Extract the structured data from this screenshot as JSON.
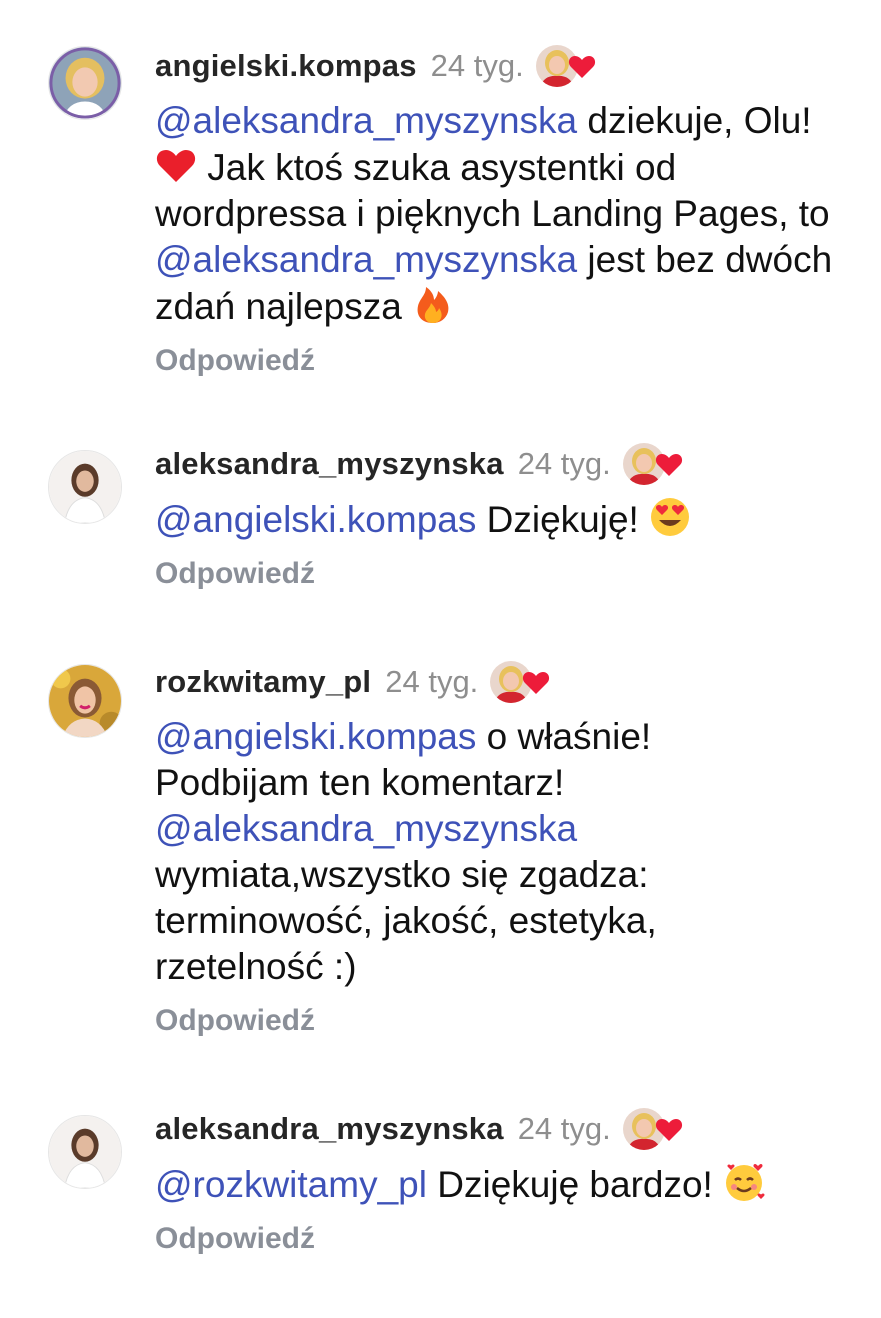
{
  "comments": [
    {
      "username": "angielski.kompas",
      "time": "24 tyg.",
      "text": {
        "m1": "@aleksandra_myszynska",
        "t1": " dziekuje, Olu! ",
        "t2": " Jak ktoś szuka asystentki od wordpressa i pięknych Landing Pages, to ",
        "m2": "@aleksandra_myszynska",
        "t3": " jest bez dwóch zdań najlepsza "
      },
      "emojis": [
        "red-heart-emoji",
        "fire-emoji"
      ],
      "reply_label": "Odpowiedź"
    },
    {
      "username": "aleksandra_myszynska",
      "time": "24 tyg.",
      "text": {
        "m1": "@angielski.kompas",
        "t1": " Dziękuję! "
      },
      "emojis": [
        "heart-eyes-emoji"
      ],
      "reply_label": "Odpowiedź"
    },
    {
      "username": "rozkwitamy_pl",
      "time": "24 tyg.",
      "text": {
        "m1": "@angielski.kompas",
        "t1": " o właśnie! Podbijam ten komentarz! ",
        "m2": "@aleksandra_myszynska",
        "t2": " wymiata,wszystko się zgadza: terminowość, jakość, estetyka, rzetelność :)"
      },
      "reply_label": "Odpowiedź"
    },
    {
      "username": "aleksandra_myszynska",
      "time": "24 tyg.",
      "text": {
        "m1": "@rozkwitamy_pl",
        "t1": " Dziękuję bardzo! "
      },
      "emojis": [
        "smiling-face-with-hearts-emoji"
      ],
      "reply_label": "Odpowiedź"
    }
  ],
  "colors": {
    "mention": "#3e52b8",
    "heart": "#ed1c3a",
    "timestamp": "#8e8e8e",
    "reply": "#8a8f98"
  },
  "icons": [
    "avatar",
    "author-liked-avatar",
    "heart-icon"
  ]
}
